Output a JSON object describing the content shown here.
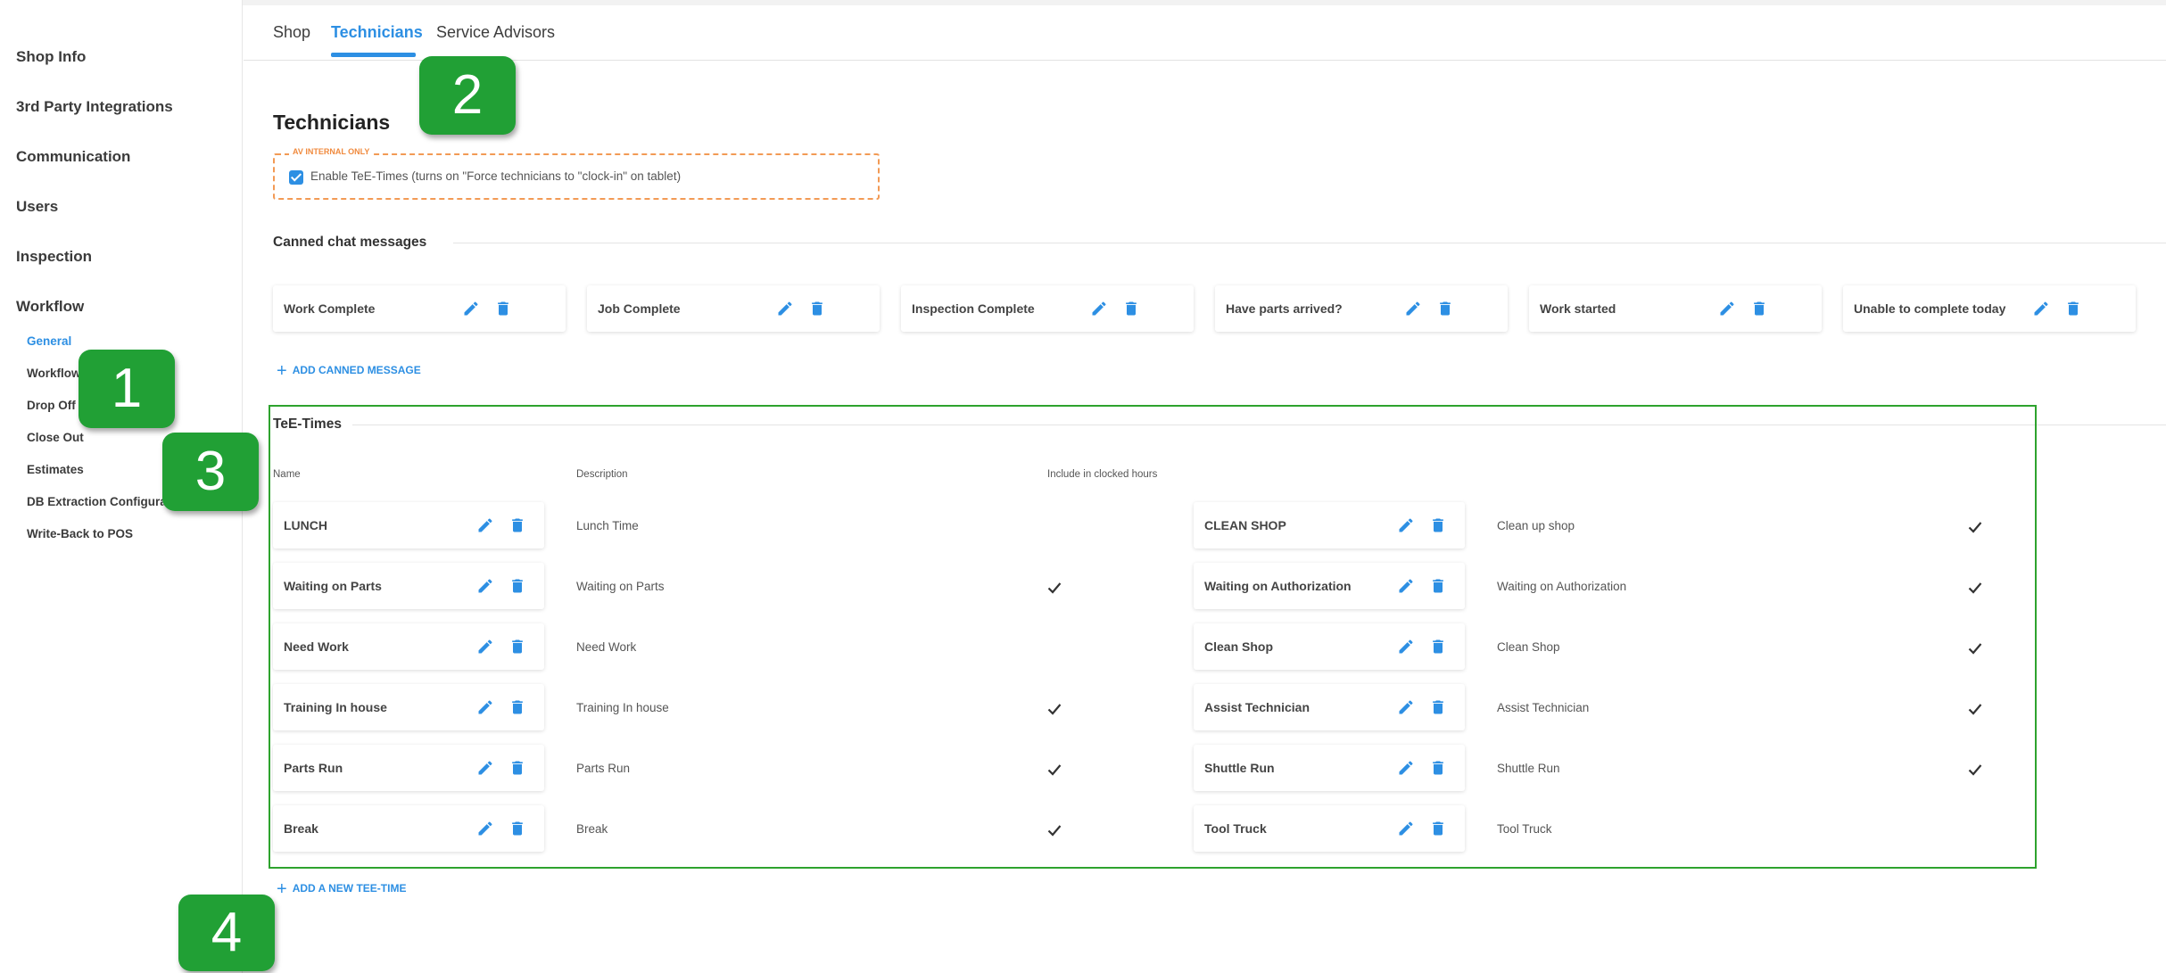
{
  "sidebar": {
    "items": [
      "Shop Info",
      "3rd Party Integrations",
      "Communication",
      "Users",
      "Inspection",
      "Workflow"
    ],
    "sub_items": [
      "General",
      "Workflow",
      "Drop Off",
      "Close Out",
      "Estimates",
      "DB Extraction Configuration",
      "Write-Back to POS"
    ],
    "active_sub": "General"
  },
  "tabs": [
    "Shop",
    "Technicians",
    "Service Advisors"
  ],
  "active_tab": "Technicians",
  "page_title": "Technicians",
  "internal": {
    "label": "AV INTERNAL ONLY",
    "checkbox_label": "Enable TeE-Times (turns on \"Force technicians to \"clock-in\" on tablet)",
    "checked": true
  },
  "canned": {
    "title": "Canned chat messages",
    "messages": [
      "Work Complete",
      "Job Complete",
      "Inspection Complete",
      "Have parts arrived?",
      "Work started",
      "Unable to complete today"
    ],
    "add_label": "ADD CANNED MESSAGE"
  },
  "tee_times": {
    "title": "TeE-Times",
    "headers": {
      "name": "Name",
      "description": "Description",
      "include": "Include in clocked hours"
    },
    "left": [
      {
        "name": "LUNCH",
        "description": "Lunch Time",
        "included": false
      },
      {
        "name": "Waiting on Parts",
        "description": "Waiting on Parts",
        "included": true
      },
      {
        "name": "Need Work",
        "description": "Need Work",
        "included": false
      },
      {
        "name": "Training In house",
        "description": "Training In house",
        "included": true
      },
      {
        "name": "Parts Run",
        "description": "Parts Run",
        "included": true
      },
      {
        "name": "Break",
        "description": "Break",
        "included": true
      }
    ],
    "right": [
      {
        "name": "CLEAN SHOP",
        "description": "Clean up shop",
        "included": true
      },
      {
        "name": "Waiting on Authorization",
        "description": "Waiting on Authorization",
        "included": true
      },
      {
        "name": "Clean Shop",
        "description": "Clean Shop",
        "included": true
      },
      {
        "name": "Assist Technician",
        "description": "Assist Technician",
        "included": true
      },
      {
        "name": "Shuttle Run",
        "description": "Shuttle Run",
        "included": true
      },
      {
        "name": "Tool Truck",
        "description": "Tool Truck",
        "included": false
      }
    ],
    "add_label": "ADD A NEW TEE-TIME"
  },
  "annotations": {
    "badges": [
      "1",
      "2",
      "3",
      "4"
    ]
  },
  "colors": {
    "accent": "#2d8fe3",
    "internal_border": "#f29a55",
    "annotation_green": "#21a035"
  }
}
